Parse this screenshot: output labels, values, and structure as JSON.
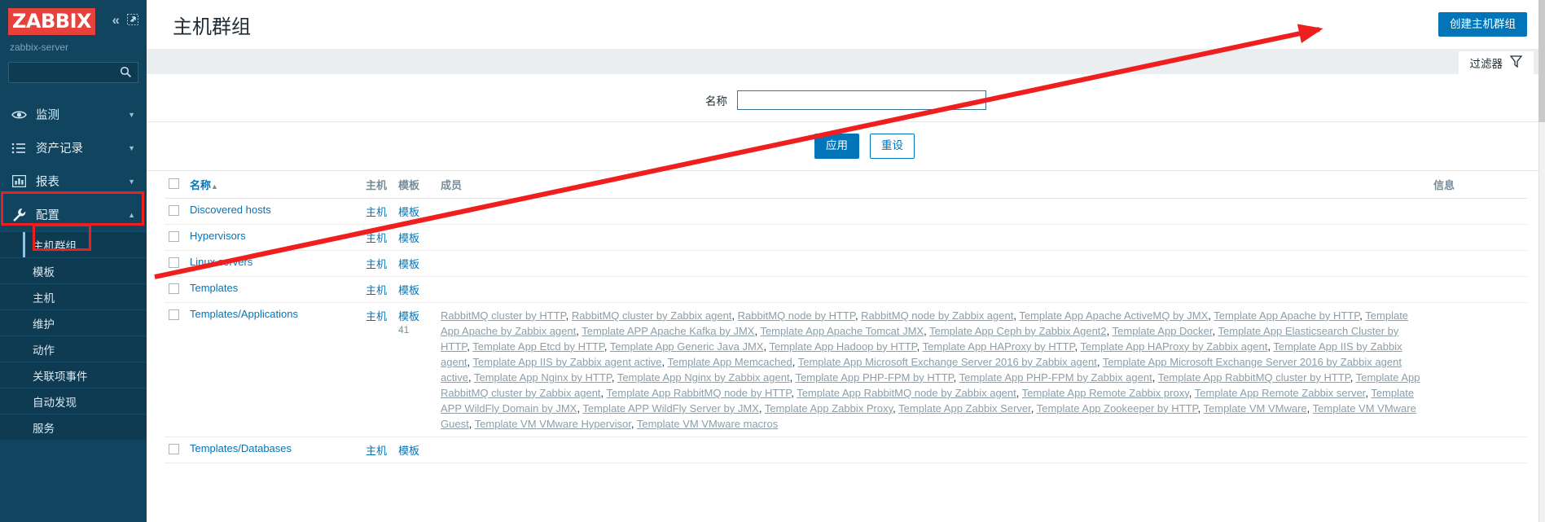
{
  "brand": {
    "logo_text": "ZABBIX",
    "server_name": "zabbix-server",
    "collapse_icon": "chevron-double-left-icon",
    "fullscreen_icon": "collapse-expand-icon",
    "logo_bg": "#e8403a"
  },
  "search": {
    "value": "",
    "placeholder": "",
    "icon": "search-icon"
  },
  "sidebar": {
    "items": [
      {
        "label": "监测",
        "icon": "eye-icon",
        "expanded": false
      },
      {
        "label": "资产记录",
        "icon": "list-icon",
        "expanded": false
      },
      {
        "label": "报表",
        "icon": "bar-chart-icon",
        "expanded": false
      },
      {
        "label": "配置",
        "icon": "wrench-icon",
        "expanded": true
      }
    ],
    "submenu": [
      {
        "label": "主机群组",
        "selected": true
      },
      {
        "label": "模板",
        "selected": false
      },
      {
        "label": "主机",
        "selected": false
      },
      {
        "label": "维护",
        "selected": false
      },
      {
        "label": "动作",
        "selected": false
      },
      {
        "label": "关联项事件",
        "selected": false
      },
      {
        "label": "自动发现",
        "selected": false
      },
      {
        "label": "服务",
        "selected": false
      }
    ]
  },
  "header": {
    "title": "主机群组",
    "create_button": "创建主机群组"
  },
  "filter": {
    "tab_label": "过滤器",
    "tab_icon": "funnel-icon",
    "name_label": "名称",
    "name_value": "",
    "apply_label": "应用",
    "reset_label": "重设"
  },
  "table": {
    "columns": {
      "name": "名称",
      "sort_arrow": "▲",
      "hosts": "主机",
      "templates": "模板",
      "members": "成员",
      "info": "信息"
    },
    "rows": [
      {
        "name": "Discovered hosts",
        "hosts_label": "主机",
        "templates_label": "模板",
        "templates_count": "",
        "members": []
      },
      {
        "name": "Hypervisors",
        "hosts_label": "主机",
        "templates_label": "模板",
        "templates_count": "",
        "members": []
      },
      {
        "name": "Linux servers",
        "hosts_label": "主机",
        "templates_label": "模板",
        "templates_count": "",
        "members": []
      },
      {
        "name": "Templates",
        "hosts_label": "主机",
        "templates_label": "模板",
        "templates_count": "",
        "members": []
      },
      {
        "name": "Templates/Applications",
        "hosts_label": "主机",
        "templates_label": "模板",
        "templates_count": "41",
        "members": [
          "RabbitMQ cluster by HTTP",
          "RabbitMQ cluster by Zabbix agent",
          "RabbitMQ node by HTTP",
          "RabbitMQ node by Zabbix agent",
          "Template App Apache ActiveMQ by JMX",
          "Template App Apache by HTTP",
          "Template App Apache by Zabbix agent",
          "Template APP Apache Kafka by JMX",
          "Template App Apache Tomcat JMX",
          "Template App Ceph by Zabbix Agent2",
          "Template App Docker",
          "Template App Elasticsearch Cluster by HTTP",
          "Template App Etcd by HTTP",
          "Template App Generic Java JMX",
          "Template App Hadoop by HTTP",
          "Template App HAProxy by HTTP",
          "Template App HAProxy by Zabbix agent",
          "Template App IIS by Zabbix agent",
          "Template App IIS by Zabbix agent active",
          "Template App Memcached",
          "Template App Microsoft Exchange Server 2016 by Zabbix agent",
          "Template App Microsoft Exchange Server 2016 by Zabbix agent active",
          "Template App Nginx by HTTP",
          "Template App Nginx by Zabbix agent",
          "Template App PHP-FPM by HTTP",
          "Template App PHP-FPM by Zabbix agent",
          "Template App RabbitMQ cluster by HTTP",
          "Template App RabbitMQ cluster by Zabbix agent",
          "Template App RabbitMQ node by HTTP",
          "Template App RabbitMQ node by Zabbix agent",
          "Template App Remote Zabbix proxy",
          "Template App Remote Zabbix server",
          "Template APP WildFly Domain by JMX",
          "Template APP WildFly Server by JMX",
          "Template App Zabbix Proxy",
          "Template App Zabbix Server",
          "Template App Zookeeper by HTTP",
          "Template VM VMware",
          "Template VM VMware Guest",
          "Template VM VMware Hypervisor",
          "Template VM VMware macros"
        ]
      },
      {
        "name": "Templates/Databases",
        "hosts_label": "主机",
        "templates_label": "模板",
        "templates_count": "",
        "members": []
      }
    ]
  },
  "annotations": {
    "arrow_color": "#f01f1f",
    "boxes": [
      "create-host-group-button",
      "config-menu-item",
      "host-group-submenu-item"
    ]
  }
}
